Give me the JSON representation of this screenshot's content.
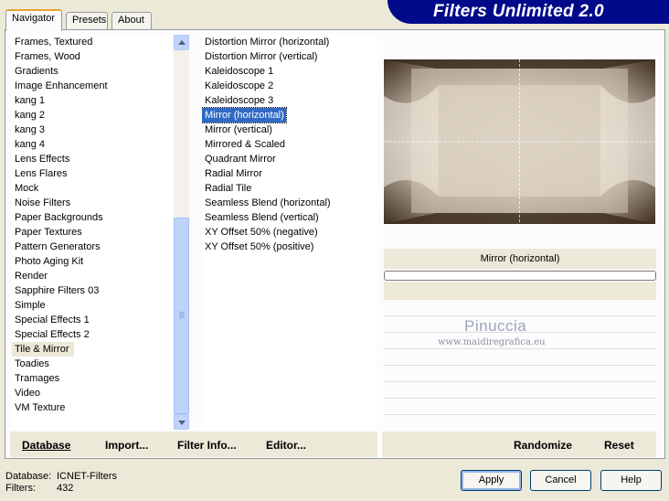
{
  "tabs": [
    {
      "label": "Navigator"
    },
    {
      "label": "Presets"
    },
    {
      "label": "About"
    }
  ],
  "app_title": "Filters Unlimited 2.0",
  "categories": [
    "Frames, Textured",
    "Frames, Wood",
    "Gradients",
    "Image Enhancement",
    "kang 1",
    "kang 2",
    "kang 3",
    "kang 4",
    "Lens Effects",
    "Lens Flares",
    "Mock",
    "Noise Filters",
    "Paper Backgrounds",
    "Paper Textures",
    "Pattern Generators",
    "Photo Aging Kit",
    "Render",
    "Sapphire Filters 03",
    "Simple",
    "Special Effects 1",
    "Special Effects 2",
    "Tile & Mirror",
    "Toadies",
    "Tramages",
    "Video",
    "VM Texture"
  ],
  "selected_category": "Tile & Mirror",
  "filters": [
    "Distortion Mirror (horizontal)",
    "Distortion Mirror (vertical)",
    "Kaleidoscope 1",
    "Kaleidoscope 2",
    "Kaleidoscope 3",
    "Mirror (horizontal)",
    "Mirror (vertical)",
    "Mirrored & Scaled",
    "Quadrant Mirror",
    "Radial Mirror",
    "Radial Tile",
    "Seamless Blend (horizontal)",
    "Seamless Blend (vertical)",
    "XY Offset 50% (negative)",
    "XY Offset 50% (positive)"
  ],
  "selected_filter": "Mirror (horizontal)",
  "preview_caption": "Mirror (horizontal)",
  "watermark": {
    "name": "Pinuccia",
    "url": "www.maidiregrafica.eu"
  },
  "toolbar": {
    "database": "Database",
    "import": "Import...",
    "filter_info": "Filter Info...",
    "editor": "Editor...",
    "randomize": "Randomize",
    "reset": "Reset"
  },
  "footer": {
    "database_label": "Database:",
    "database_value": "ICNET-Filters",
    "filters_label": "Filters:",
    "filters_value": "432"
  },
  "buttons": {
    "apply": "Apply",
    "cancel": "Cancel",
    "help": "Help"
  },
  "colors": {
    "banner": "#000a8a",
    "selection": "#316ac5",
    "dialog_bg": "#ece9d8"
  }
}
